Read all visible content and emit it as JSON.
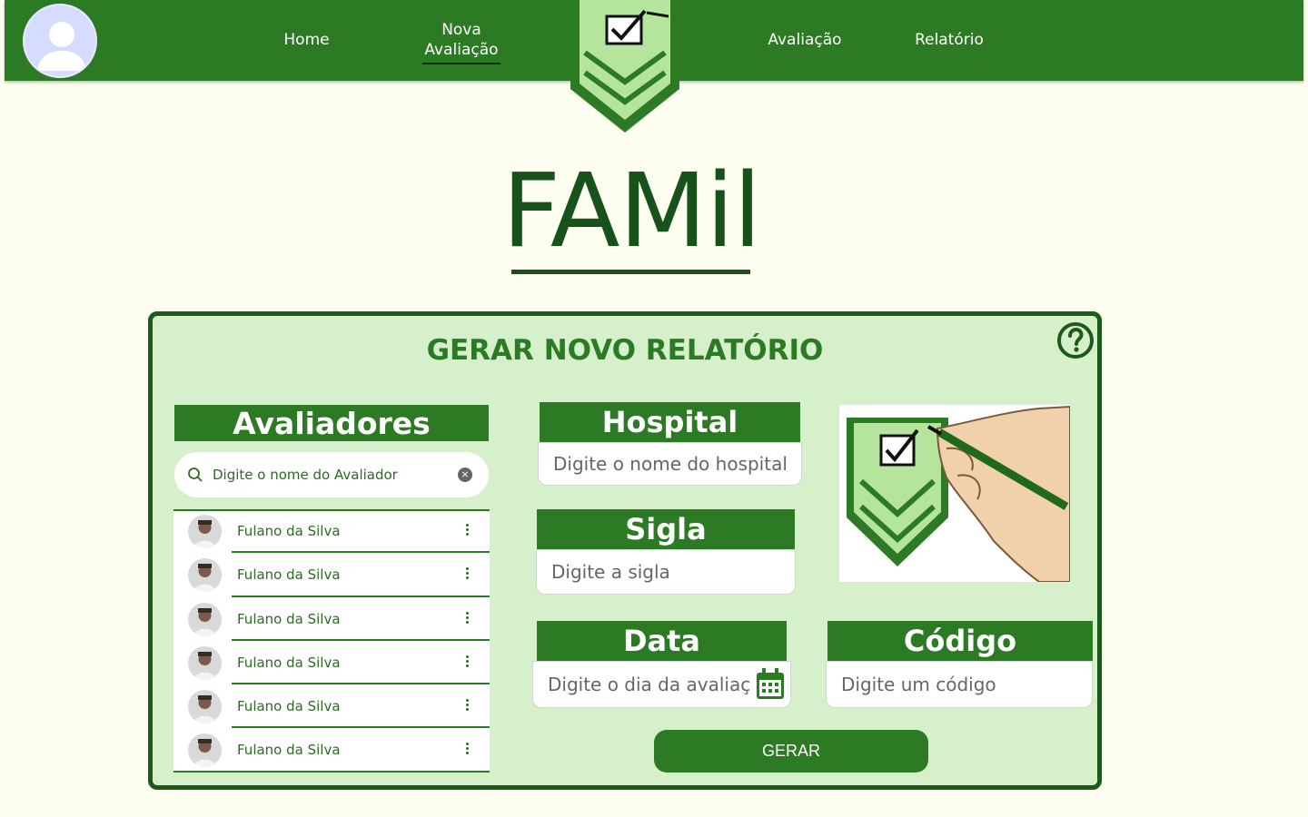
{
  "nav": {
    "home": "Home",
    "nova_line1": "Nova",
    "nova_line2": "Avaliação",
    "avaliacao": "Avaliação",
    "relatorio": "Relatório"
  },
  "brand": {
    "title": "FAMil"
  },
  "panel": {
    "title": "GERAR NOVO RELATÓRIO",
    "avaliadores": {
      "heading": "Avaliadores",
      "search_placeholder": "Digite o nome do Avaliador",
      "items": [
        {
          "name": "Fulano da Silva"
        },
        {
          "name": "Fulano da Silva"
        },
        {
          "name": "Fulano da Silva"
        },
        {
          "name": "Fulano da Silva"
        },
        {
          "name": "Fulano da Silva"
        },
        {
          "name": "Fulano da Silva"
        }
      ]
    },
    "hospital": {
      "heading": "Hospital",
      "placeholder": "Digite o nome do hospital"
    },
    "sigla": {
      "heading": "Sigla",
      "placeholder": "Digite a sigla"
    },
    "data": {
      "heading": "Data",
      "placeholder": "Digite o dia da avaliação"
    },
    "codigo": {
      "heading": "Código",
      "placeholder": "Digite um código"
    },
    "submit_label": "GERAR"
  },
  "colors": {
    "primary": "#2d7a24",
    "dark": "#17521a",
    "panel_bg": "#d5f0ca",
    "page_bg": "#fefef0"
  }
}
